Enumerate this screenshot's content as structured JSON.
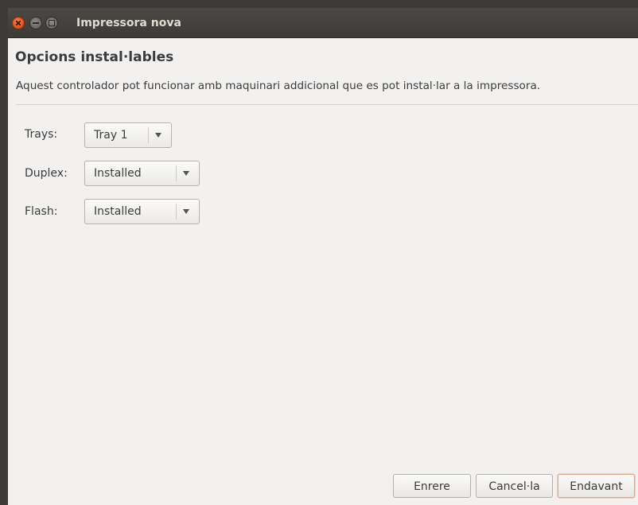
{
  "window": {
    "title": "Impressora nova"
  },
  "page": {
    "heading": "Opcions instal·lables",
    "description": "Aquest controlador pot funcionar amb maquinari addicional que es pot instal·lar a la impressora."
  },
  "options": [
    {
      "label": "Trays:",
      "value": "Tray 1"
    },
    {
      "label": "Duplex:",
      "value": "Installed"
    },
    {
      "label": "Flash:",
      "value": "Installed"
    }
  ],
  "buttons": {
    "back": "Enrere",
    "cancel": "Cancel·la",
    "forward": "Endavant"
  },
  "colors": {
    "titlebar": "#3c3b37",
    "background": "#f2f1f0",
    "close_button": "#e5541f",
    "default_button_border": "#e0a586"
  },
  "icons": [
    "close-icon",
    "minimize-icon",
    "maximize-icon",
    "dropdown-arrow-icon"
  ]
}
